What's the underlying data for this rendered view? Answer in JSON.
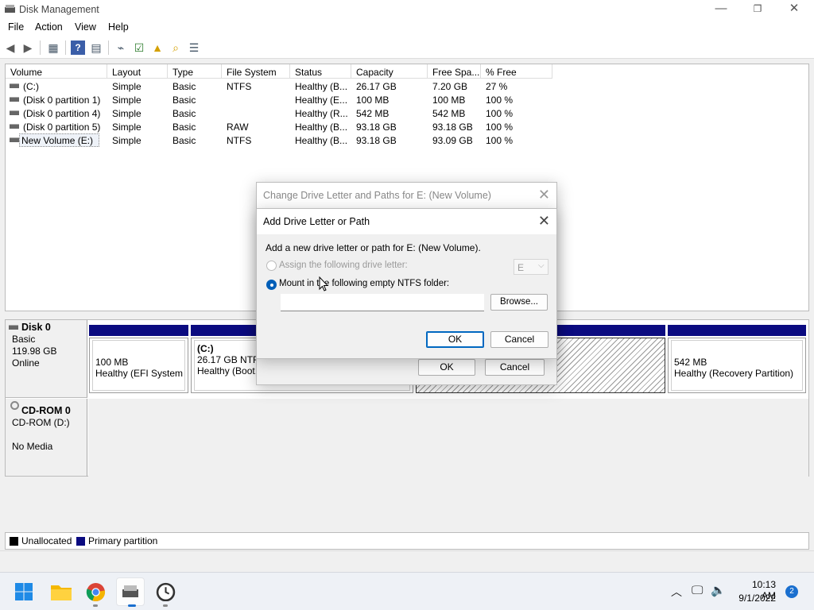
{
  "window": {
    "title": "Disk Management",
    "controls": {
      "minimize": "—",
      "restore": "❐",
      "close": "✕"
    }
  },
  "menu": [
    "File",
    "Action",
    "View",
    "Help"
  ],
  "toolbar_icons": [
    "back-arrow-icon",
    "forward-arrow-icon",
    "properties-grid-icon",
    "help-icon",
    "console-tree-icon",
    "connect-icon",
    "check-icon",
    "folder-up-icon",
    "search-folder-icon",
    "list-icon"
  ],
  "volume_list": {
    "columns": [
      "Volume",
      "Layout",
      "Type",
      "File System",
      "Status",
      "Capacity",
      "Free Spa...",
      "% Free"
    ],
    "rows": [
      {
        "volume": "(C:)",
        "layout": "Simple",
        "type": "Basic",
        "fs": "NTFS",
        "status": "Healthy (B...",
        "capacity": "26.17 GB",
        "free": "7.20 GB",
        "pct": "27 %"
      },
      {
        "volume": "(Disk 0 partition 1)",
        "layout": "Simple",
        "type": "Basic",
        "fs": "",
        "status": "Healthy (E...",
        "capacity": "100 MB",
        "free": "100 MB",
        "pct": "100 %"
      },
      {
        "volume": "(Disk 0 partition 4)",
        "layout": "Simple",
        "type": "Basic",
        "fs": "",
        "status": "Healthy (R...",
        "capacity": "542 MB",
        "free": "542 MB",
        "pct": "100 %"
      },
      {
        "volume": "(Disk 0 partition 5)",
        "layout": "Simple",
        "type": "Basic",
        "fs": "RAW",
        "status": "Healthy (B...",
        "capacity": "93.18 GB",
        "free": "93.18 GB",
        "pct": "100 %"
      },
      {
        "volume": "New Volume (E:)",
        "layout": "Simple",
        "type": "Basic",
        "fs": "NTFS",
        "status": "Healthy (B...",
        "capacity": "93.18 GB",
        "free": "93.09 GB",
        "pct": "100 %"
      }
    ]
  },
  "disk0": {
    "name": "Disk 0",
    "type": "Basic",
    "size": "119.98 GB",
    "state": "Online",
    "partitions": [
      {
        "size": "100 MB",
        "status": "Healthy (EFI System P"
      },
      {
        "label": "(C:)",
        "size": "26.17 GB NTFS",
        "status": "Healthy (Boot,"
      },
      {
        "size": "542 MB",
        "status": "Healthy (Recovery Partition)"
      }
    ]
  },
  "cdrom0": {
    "name": "CD-ROM 0",
    "drive": "CD-ROM (D:)",
    "media": "No Media"
  },
  "legend": [
    {
      "label": "Unallocated",
      "color": "#000000"
    },
    {
      "label": "Primary partition",
      "color": "#0b0b80"
    }
  ],
  "parent_dialog": {
    "title": "Change Drive Letter and Paths for E: (New Volume)",
    "ok": "OK",
    "cancel": "Cancel"
  },
  "dialog": {
    "title": "Add Drive Letter or Path",
    "description": "Add a new drive letter or path for E: (New Volume).",
    "option_letter": "Assign the following drive letter:",
    "letter_value": "E",
    "option_mount": "Mount in the following empty NTFS folder:",
    "folder_value": "",
    "browse": "Browse...",
    "ok": "OK",
    "cancel": "Cancel"
  },
  "taskbar": {
    "apps": [
      "windows-start-icon",
      "file-explorer-icon",
      "chrome-icon",
      "disk-management-icon",
      "clock-app-icon"
    ],
    "time": "10:13 AM",
    "date": "9/1/2022",
    "notification_count": "2"
  }
}
